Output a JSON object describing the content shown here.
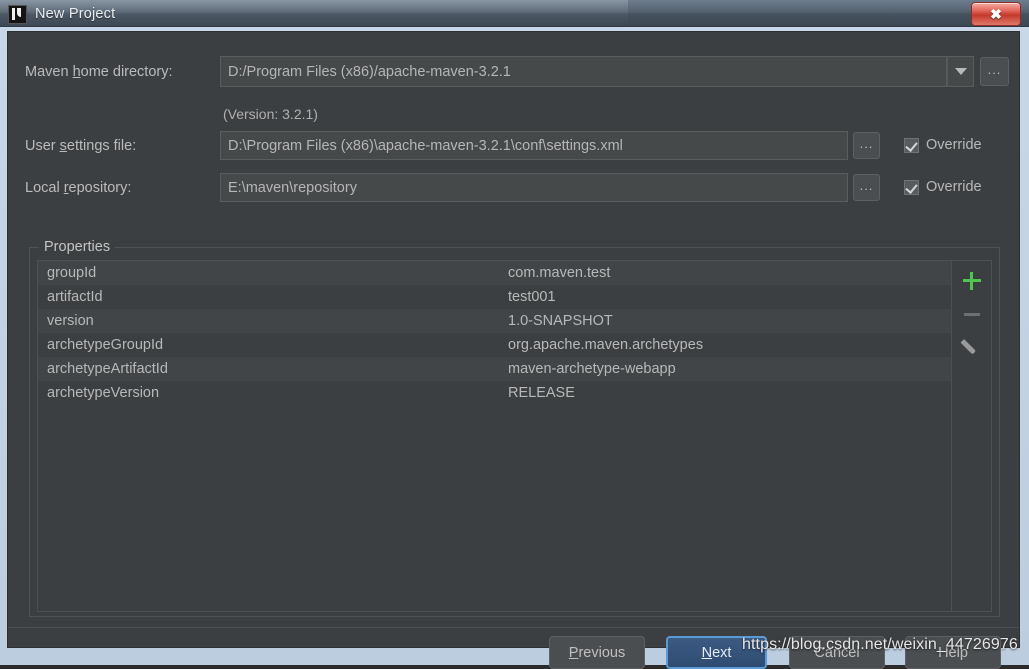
{
  "window": {
    "title": "New Project",
    "app_icon": "intellij-idea-icon",
    "close_label": "✖"
  },
  "form": {
    "maven_home": {
      "label_before": "Maven ",
      "label_mnemonic": "h",
      "label_after": "ome directory:",
      "value": "D:/Program Files (x86)/apache-maven-3.2.1",
      "browse_label": "...",
      "version_note": "(Version: 3.2.1)"
    },
    "user_settings": {
      "label_before": "User ",
      "label_mnemonic": "s",
      "label_after": "ettings file:",
      "value": "D:\\Program Files (x86)\\apache-maven-3.2.1\\conf\\settings.xml",
      "browse_label": "...",
      "override_label": "Override",
      "override_checked": true
    },
    "local_repository": {
      "label_before": "Local ",
      "label_mnemonic": "r",
      "label_after": "epository:",
      "value": "E:\\maven\\repository",
      "browse_label": "...",
      "override_label": "Override",
      "override_checked": true
    }
  },
  "properties": {
    "legend": "Properties",
    "rows": [
      {
        "key": "groupId",
        "value": "com.maven.test"
      },
      {
        "key": "artifactId",
        "value": "test001"
      },
      {
        "key": "version",
        "value": "1.0-SNAPSHOT"
      },
      {
        "key": "archetypeGroupId",
        "value": "org.apache.maven.archetypes"
      },
      {
        "key": "archetypeArtifactId",
        "value": "maven-archetype-webapp"
      },
      {
        "key": "archetypeVersion",
        "value": "RELEASE"
      }
    ],
    "toolbar": {
      "add": "add-property",
      "remove": "remove-property",
      "edit": "edit-property"
    }
  },
  "buttons": {
    "previous": {
      "before": "",
      "mnemonic": "P",
      "after": "revious"
    },
    "next": {
      "before": "",
      "mnemonic": "N",
      "after": "ext"
    },
    "cancel": {
      "label": "Cancel"
    },
    "help": {
      "label": "Help"
    }
  },
  "watermark": "https://blog.csdn.net/weixin_44726976",
  "colors": {
    "dialog_bg": "#3c3f41",
    "field_bg": "#45494a",
    "accent_blue": "#5b9bd5",
    "add_green": "#4fc44f",
    "close_red": "#c33a2c"
  }
}
